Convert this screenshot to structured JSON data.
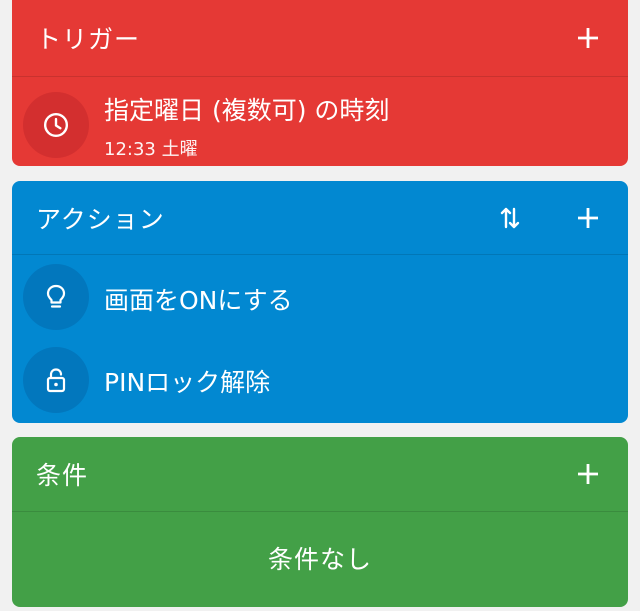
{
  "trigger": {
    "title": "トリガー",
    "item": {
      "icon": "clock-icon",
      "title": "指定曜日 (複数可) の時刻",
      "subtitle": "12:33 土曜"
    }
  },
  "action": {
    "title": "アクション",
    "items": [
      {
        "icon": "lightbulb-icon",
        "label": "画面をONにする"
      },
      {
        "icon": "unlock-icon",
        "label": "PINロック解除"
      }
    ]
  },
  "condition": {
    "title": "条件",
    "empty_label": "条件なし"
  },
  "colors": {
    "trigger": "#e53935",
    "action": "#0288d1",
    "condition": "#43a047"
  }
}
